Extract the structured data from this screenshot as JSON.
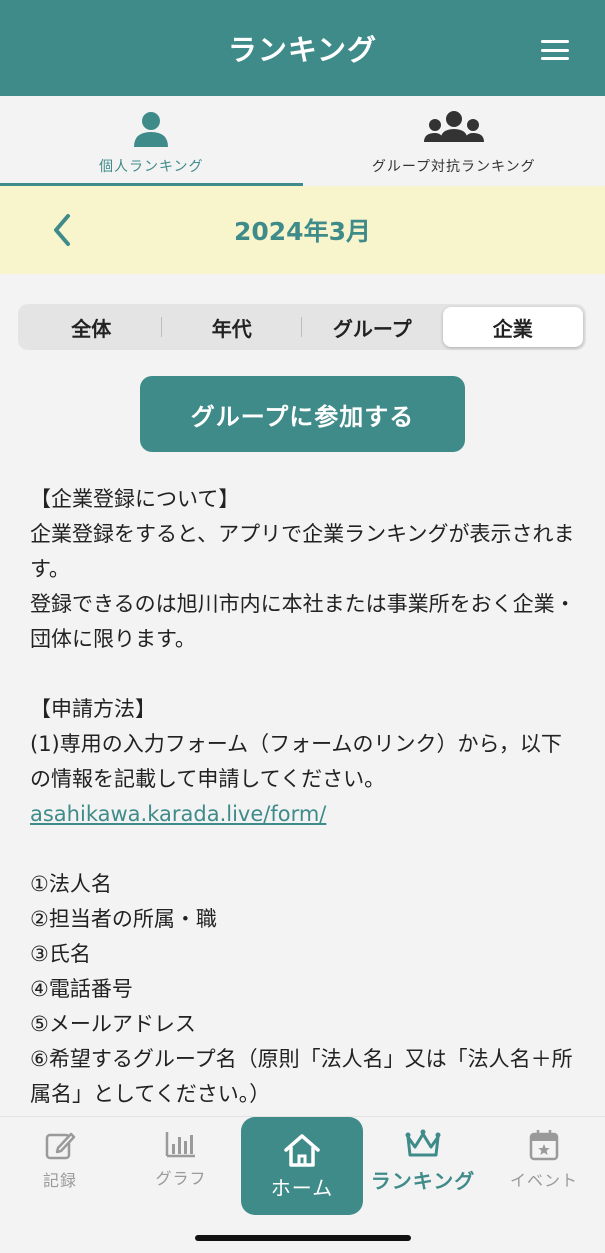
{
  "header": {
    "title": "ランキング"
  },
  "tabs": [
    {
      "label": "個人ランキング",
      "icon": "person-icon"
    },
    {
      "label": "グループ対抗ランキング",
      "icon": "group-icon"
    }
  ],
  "month": {
    "label": "2024年3月"
  },
  "segments": [
    "全体",
    "年代",
    "グループ",
    "企業"
  ],
  "selected_segment": "企業",
  "join_button": {
    "label": "グループに参加する"
  },
  "content": {
    "lines": [
      "【企業登録について】",
      "企業登録をすると、アプリで企業ランキングが表示されます。",
      "登録できるのは旭川市内に本社または事業所をおく企業・団体に限ります。",
      "",
      "【申請方法】",
      "(1)専用の入力フォーム（フォームのリンク）から，以下の情報を記載して申請してください。"
    ],
    "link": "asahikawa.karada.live/form/",
    "items": [
      "①法人名",
      "②担当者の所属・職",
      "③氏名",
      "④電話番号",
      "⑤メールアドレス",
      "⑥希望するグループ名（原則「法人名」又は「法人名＋所属名」としてください。）"
    ]
  },
  "bottom_nav": {
    "record": "記録",
    "graph": "グラフ",
    "home": "ホーム",
    "ranking": "ランキング",
    "event": "イベント"
  },
  "colors": {
    "primary": "#3f8b8a",
    "month_bar": "#f8f4cc",
    "background": "#f3f3f3"
  }
}
